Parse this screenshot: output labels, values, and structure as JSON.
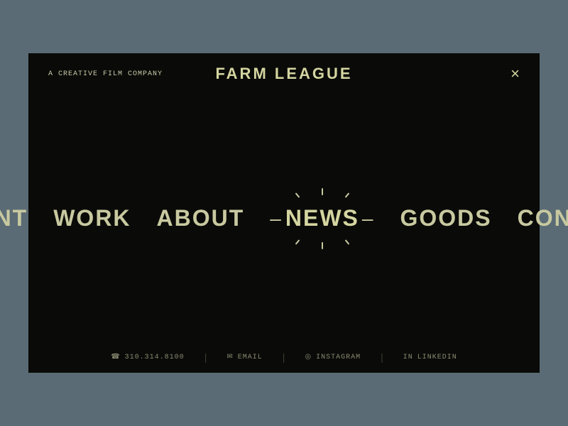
{
  "header": {
    "tagline": "A Creative Film Company",
    "logo": "Farm League",
    "close_label": "×"
  },
  "nav": {
    "items": [
      {
        "id": "talent",
        "label": "TALENT",
        "active": false
      },
      {
        "id": "work",
        "label": "WORK",
        "active": false
      },
      {
        "id": "about",
        "label": "ABOUT",
        "active": false
      },
      {
        "id": "news",
        "label": "NEWS",
        "active": true
      },
      {
        "id": "goods",
        "label": "GOODS",
        "active": false
      },
      {
        "id": "contact",
        "label": "CONTACT",
        "active": false
      }
    ]
  },
  "footer": {
    "phone": "310.314.8100",
    "email_label": "EMAIL",
    "instagram_label": "INSTAGRAM",
    "linkedin_label": "LINKEDIN"
  }
}
